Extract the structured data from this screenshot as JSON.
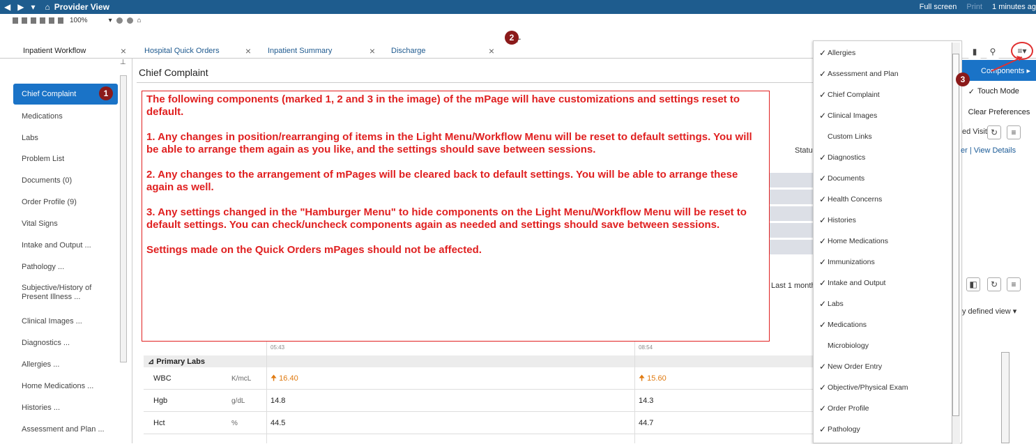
{
  "titlebar": {
    "back": "◀",
    "forward": "▶",
    "dropdown": "▾",
    "home": "⌂",
    "title": "Provider View",
    "full_screen": "Full screen",
    "print": "Print",
    "refresh": "1 minutes ag"
  },
  "toolbar": {
    "zoom": "100%"
  },
  "tabs": [
    {
      "label": "Inpatient Workflow"
    },
    {
      "label": "Hospital Quick Orders"
    },
    {
      "label": "Inpatient Summary"
    },
    {
      "label": "Discharge"
    }
  ],
  "tab_close": "×",
  "add_tab": "+",
  "badges": {
    "one": "1",
    "two": "2",
    "three": "3"
  },
  "sidebar": {
    "items": [
      "Chief Complaint",
      "Medications",
      "Labs",
      "Problem List",
      "Documents (0)",
      "Order Profile (9)",
      "Vital Signs",
      "Intake and Output ...",
      "Pathology ...",
      "Subjective/History of Present Illness ...",
      "Clinical Images ...",
      "Diagnostics ...",
      "Allergies ...",
      "Home Medications ...",
      "Histories ...",
      "Assessment and Plan ..."
    ]
  },
  "main": {
    "title": "Chief Complaint",
    "status_frag": "Statu",
    "last_month": "Last 1 month",
    "section_primary": "⊿ Primary Labs",
    "time_a": "05:43",
    "time_b": "08:54",
    "rows": [
      {
        "name": "WBC",
        "unit": "K/mcL",
        "v1": "16.40",
        "v2": "15.60",
        "high": true
      },
      {
        "name": "Hgb",
        "unit": "g/dL",
        "v1": "14.8",
        "v2": "14.3",
        "high": false
      },
      {
        "name": "Hct",
        "unit": "%",
        "v1": "44.5",
        "v2": "44.7",
        "high": false
      }
    ]
  },
  "annotation": {
    "p1": "The following components (marked 1, 2 and 3 in the image) of the mPage will have customizations and settings reset to default.",
    "p2": "1. Any changes in position/rearranging of items in the Light Menu/Workflow Menu will be reset to default settings. You will be able to arrange them again as you like, and the settings should save between sessions.",
    "p3": "2. Any changes to the arrangement of mPages will be cleared back to default settings. You will be able to arrange these again as well.",
    "p4": "3. Any settings changed in the \"Hamburger Menu\" to hide components on the Light Menu/Workflow Menu will be reset to default settings. You can check/uncheck components again as needed and settings should save between sessions.",
    "p5": "Settings made on the Quick Orders mPages should not be affected."
  },
  "components_list": [
    {
      "label": "Allergies",
      "checked": true
    },
    {
      "label": "Assessment and Plan",
      "checked": true
    },
    {
      "label": "Chief Complaint",
      "checked": true
    },
    {
      "label": "Clinical Images",
      "checked": true
    },
    {
      "label": "Custom Links",
      "checked": false
    },
    {
      "label": "Diagnostics",
      "checked": true
    },
    {
      "label": "Documents",
      "checked": true
    },
    {
      "label": "Health Concerns",
      "checked": true
    },
    {
      "label": "Histories",
      "checked": true
    },
    {
      "label": "Home Medications",
      "checked": true
    },
    {
      "label": "Immunizations",
      "checked": true
    },
    {
      "label": "Intake and Output",
      "checked": true
    },
    {
      "label": "Labs",
      "checked": true
    },
    {
      "label": "Medications",
      "checked": true
    },
    {
      "label": "Microbiology",
      "checked": false
    },
    {
      "label": "New Order Entry",
      "checked": true
    },
    {
      "label": "Objective/Physical Exam",
      "checked": true
    },
    {
      "label": "Order Profile",
      "checked": true
    },
    {
      "label": "Pathology",
      "checked": true
    }
  ],
  "hamburger_menu": {
    "components": "Components ▸",
    "touch_mode": "Touch Mode",
    "clear_prefs": "Clear Preferences",
    "icon": "≡▾"
  },
  "right_frags": {
    "ed_visit": "ed Visit",
    "er_view": "er | View Details",
    "defined_view": "y defined view ▾"
  },
  "colors": {
    "accent": "#1a73c7",
    "titlebar": "#1e5c8e",
    "annotation": "#e02020",
    "badge": "#8b1a1a"
  }
}
